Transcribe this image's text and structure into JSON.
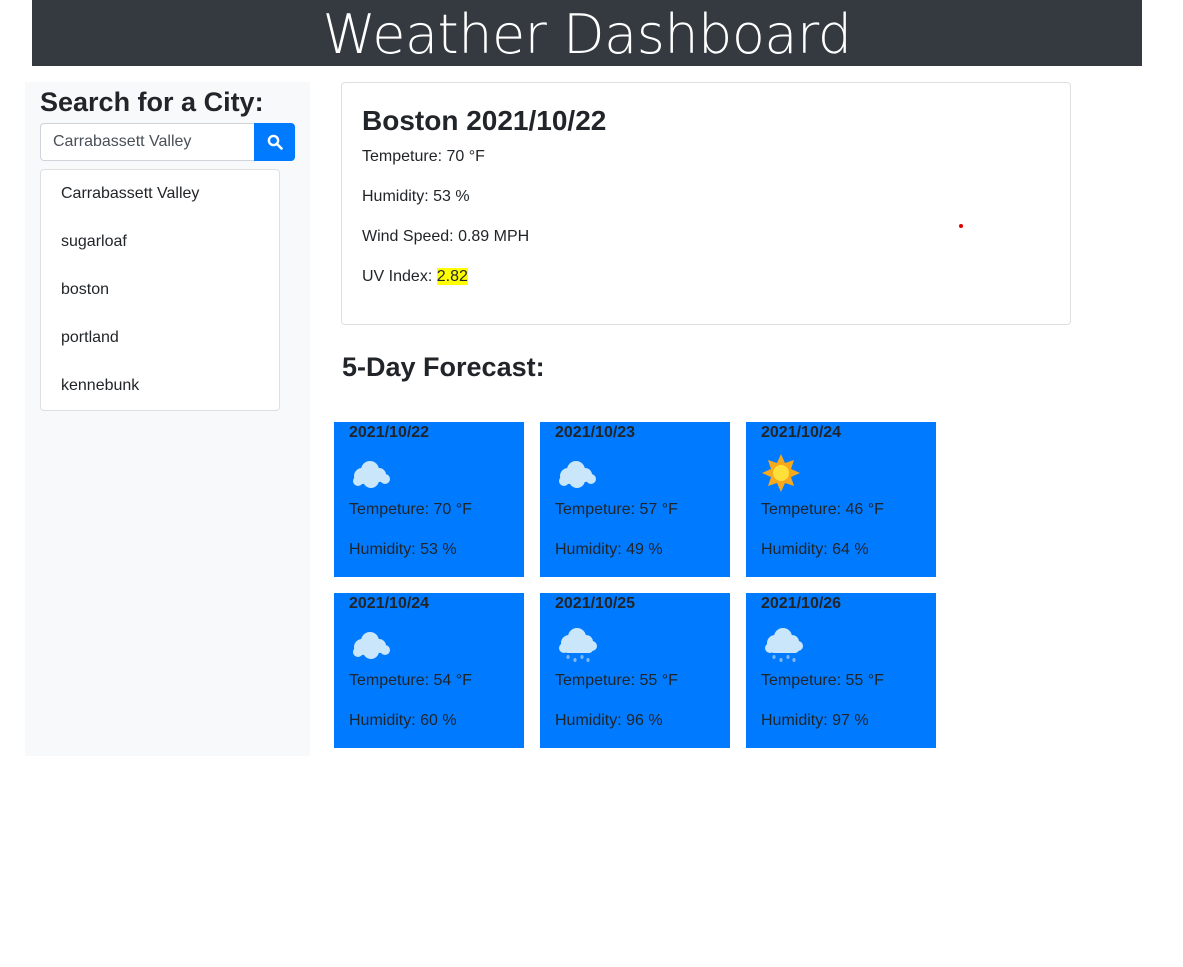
{
  "header": {
    "title": "Weather Dashboard"
  },
  "search": {
    "title": "Search for a City:",
    "input_value": "Carrabassett Valley",
    "button_icon": "search-icon",
    "history": [
      "Carrabassett Valley",
      "sugarloaf",
      "boston",
      "portland",
      "kennebunk"
    ]
  },
  "current": {
    "title": "Boston 2021/10/22",
    "temperature_label": "Tempeture:",
    "temperature": "70 °F",
    "humidity_label": "Humidity:",
    "humidity": "53 %",
    "wind_label": "Wind Speed:",
    "wind": "0.89 MPH",
    "uv_label": "UV Index:",
    "uv": "2.82",
    "uv_color": "#ffff00"
  },
  "forecast": {
    "title": "5-Day Forecast:",
    "temp_label": "Tempeture:",
    "humidity_label": "Humidity:",
    "cards": [
      {
        "date": "2021/10/22",
        "icon": "cloud-icon",
        "temp": "70 °F",
        "humidity": "53 %"
      },
      {
        "date": "2021/10/23",
        "icon": "cloud-icon",
        "temp": "57 °F",
        "humidity": "49 %"
      },
      {
        "date": "2021/10/24",
        "icon": "sun-icon",
        "temp": "46 °F",
        "humidity": "64 %"
      },
      {
        "date": "2021/10/24",
        "icon": "cloud-icon",
        "temp": "54 °F",
        "humidity": "60 %"
      },
      {
        "date": "2021/10/25",
        "icon": "rain-cloud-icon",
        "temp": "55 °F",
        "humidity": "96 %"
      },
      {
        "date": "2021/10/26",
        "icon": "rain-cloud-icon",
        "temp": "55 °F",
        "humidity": "97 %"
      }
    ]
  },
  "colors": {
    "header_bg": "#343a40",
    "accent": "#007bff",
    "sidebar_bg": "#f8f9fa"
  }
}
